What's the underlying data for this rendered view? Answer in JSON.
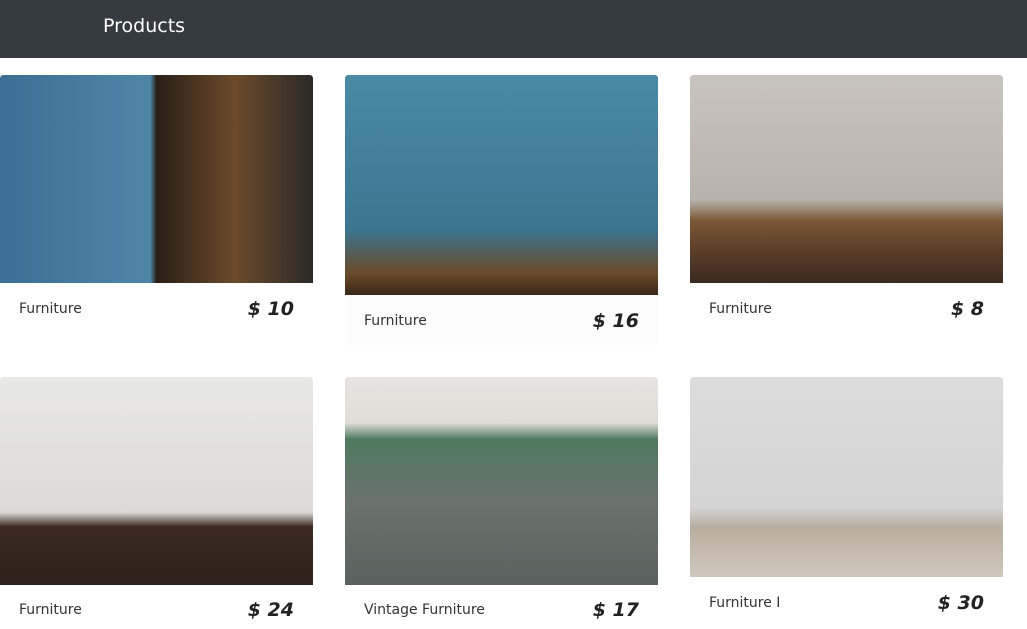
{
  "header": {
    "title": "Products"
  },
  "products": [
    {
      "name": "Furniture",
      "price": "$ 10",
      "image": "blue display cabinet with shelves",
      "color": "#3a5f7a"
    },
    {
      "name": "Furniture",
      "price": "$ 16",
      "image": "decor on shelf against blue wall",
      "color": "#3f7d96"
    },
    {
      "name": "Furniture",
      "price": "$ 8",
      "image": "round wooden table with bottle",
      "color": "#8a7d70"
    },
    {
      "name": "Furniture",
      "price": "$ 24",
      "image": "stereo on dresser with wall art",
      "color": "#b0a9a0"
    },
    {
      "name": "Vintage Furniture",
      "price": "$ 17",
      "image": "sofa with cactus pillow",
      "color": "#6f7a72"
    },
    {
      "name": "Furniture I",
      "price": "$ 30",
      "image": "two patterned chairs",
      "color": "#c9c6c0"
    }
  ]
}
